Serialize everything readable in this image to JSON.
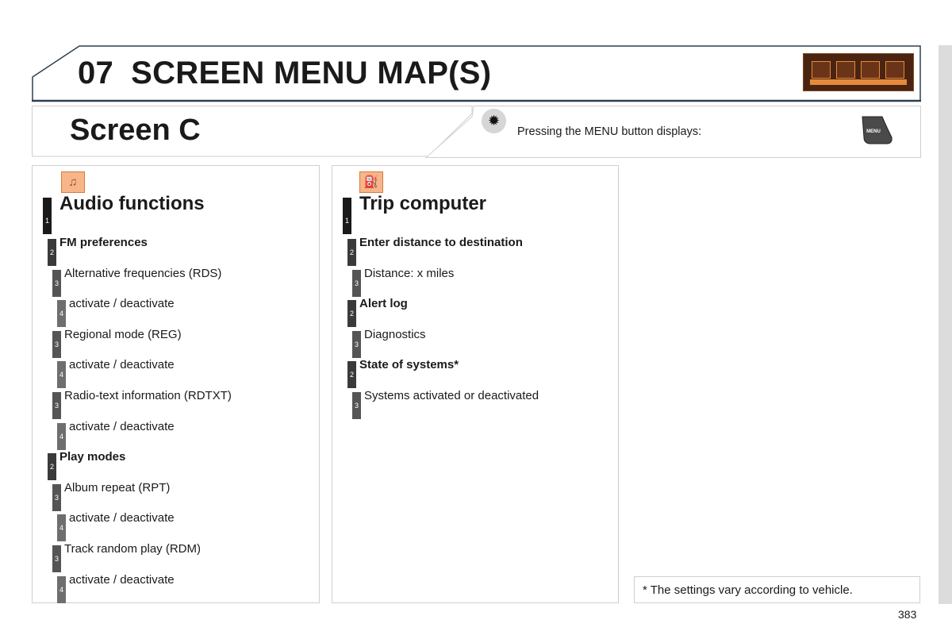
{
  "chapter": {
    "number": "07",
    "title": "SCREEN MENU MAP(S)",
    "icons": [
      "audio-icon",
      "trip-computer-icon",
      "settings-icon",
      "telephone-icon"
    ]
  },
  "screen": {
    "title": "Screen C",
    "tip_icon": "lightbulb-icon",
    "instruction": "Pressing the MENU button displays:",
    "menu_key_label": "MENU"
  },
  "panels": [
    {
      "icon": "audio-icon",
      "items": [
        {
          "level": 1,
          "label": "Audio functions"
        },
        {
          "level": 2,
          "label": "FM preferences"
        },
        {
          "level": 3,
          "label": "Alternative frequencies (RDS)"
        },
        {
          "level": 4,
          "label": "activate / deactivate"
        },
        {
          "level": 3,
          "label": "Regional mode (REG)"
        },
        {
          "level": 4,
          "label": "activate / deactivate"
        },
        {
          "level": 3,
          "label": "Radio-text information (RDTXT)"
        },
        {
          "level": 4,
          "label": "activate / deactivate"
        },
        {
          "level": 2,
          "label": "Play modes"
        },
        {
          "level": 3,
          "label": "Album repeat (RPT)"
        },
        {
          "level": 4,
          "label": "activate / deactivate"
        },
        {
          "level": 3,
          "label": "Track random play (RDM)"
        },
        {
          "level": 4,
          "label": "activate / deactivate"
        }
      ]
    },
    {
      "icon": "trip-computer-icon",
      "items": [
        {
          "level": 1,
          "label": "Trip computer"
        },
        {
          "level": 2,
          "label": "Enter distance to destination"
        },
        {
          "level": 3,
          "label": "Distance: x miles"
        },
        {
          "level": 2,
          "label": "Alert log"
        },
        {
          "level": 3,
          "label": "Diagnostics"
        },
        {
          "level": 2,
          "label": "State of systems*"
        },
        {
          "level": 3,
          "label": "Systems activated or deactivated"
        }
      ]
    }
  ],
  "footnote": "* The settings vary according to vehicle.",
  "page_number": "383"
}
